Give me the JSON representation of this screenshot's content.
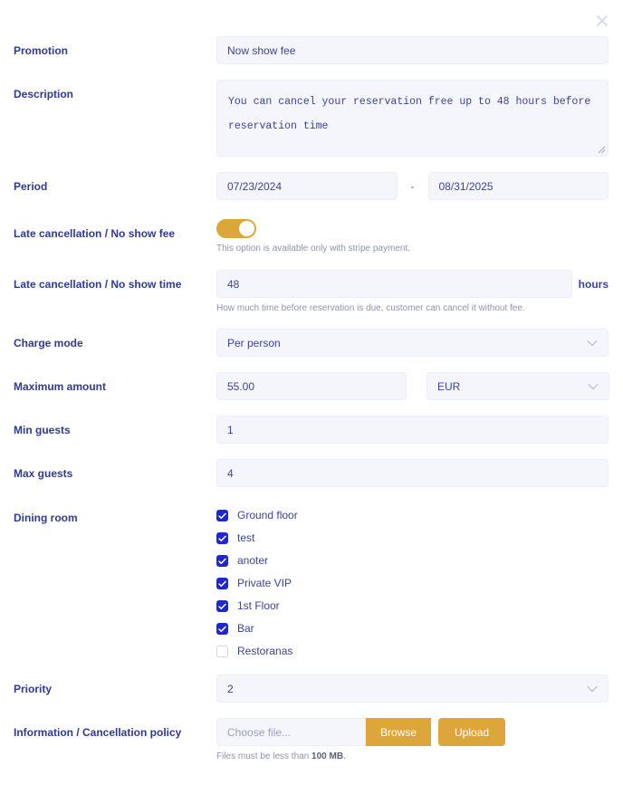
{
  "dialog": {
    "close_icon": "close-icon"
  },
  "fields": {
    "promotion": {
      "label": "Promotion",
      "value": "Now show fee"
    },
    "description": {
      "label": "Description",
      "value": "You can cancel your reservation free up to 48 hours before reservation time"
    },
    "period": {
      "label": "Period",
      "start": "07/23/2024",
      "separator": "-",
      "end": "08/31/2025"
    },
    "no_show_fee": {
      "label": "Late cancellation / No show fee",
      "toggle_state": "on",
      "helper": "This option is available only with stripe payment."
    },
    "no_show_time": {
      "label": "Late cancellation / No show time",
      "value": "48",
      "suffix": "hours",
      "helper": "How much time before reservation is due, customer can cancel it without fee."
    },
    "charge_mode": {
      "label": "Charge mode",
      "value": "Per person",
      "chevron_icon": "chevron-down-icon"
    },
    "maximum_amount": {
      "label": "Maximum amount",
      "value": "55.00",
      "currency": "EUR",
      "chevron_icon": "chevron-down-icon"
    },
    "min_guests": {
      "label": "Min guests",
      "value": "1"
    },
    "max_guests": {
      "label": "Max guests",
      "value": "4"
    },
    "dining_room": {
      "label": "Dining room",
      "options": [
        {
          "label": "Ground floor",
          "checked": true
        },
        {
          "label": "test",
          "checked": true
        },
        {
          "label": "anoter",
          "checked": true
        },
        {
          "label": "Private VIP",
          "checked": true
        },
        {
          "label": "1st Floor",
          "checked": true
        },
        {
          "label": "Bar",
          "checked": true
        },
        {
          "label": "Restoranas",
          "checked": false
        }
      ]
    },
    "priority": {
      "label": "Priority",
      "value": "2",
      "chevron_icon": "chevron-down-icon"
    },
    "cancellation_policy": {
      "label": "Information / Cancellation policy",
      "file_placeholder": "Choose file...",
      "browse_label": "Browse",
      "upload_label": "Upload",
      "helper_prefix": "Files must be less than ",
      "helper_strong": "100 MB",
      "helper_suffix": "."
    }
  },
  "colors": {
    "label": "#2f3a8f",
    "field_bg": "#f5f6fb",
    "accent_gold": "#dda63a",
    "checkbox_blue": "#2026d2",
    "helper_gray": "#8f93ad"
  }
}
